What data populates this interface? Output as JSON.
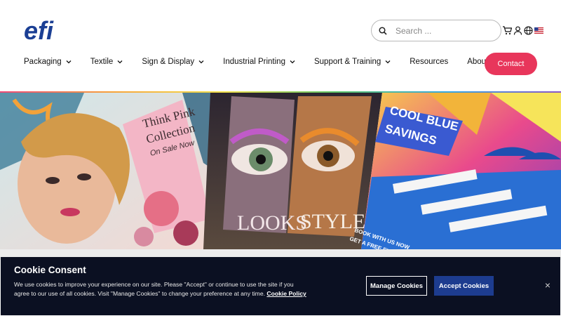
{
  "header": {
    "logo_text": "efi",
    "search": {
      "placeholder": "Search ..."
    },
    "icons": [
      "cart-icon",
      "user-icon",
      "globe-icon",
      "us-flag-icon"
    ]
  },
  "nav": {
    "items": [
      {
        "label": "Packaging",
        "dropdown": true
      },
      {
        "label": "Textile",
        "dropdown": true
      },
      {
        "label": "Sign & Display",
        "dropdown": true
      },
      {
        "label": "Industrial Printing",
        "dropdown": true
      },
      {
        "label": "Support & Training",
        "dropdown": true
      },
      {
        "label": "Resources",
        "dropdown": false
      },
      {
        "label": "About",
        "dropdown": true
      }
    ],
    "contact_label": "Contact"
  },
  "hero": {
    "panel1_line1": "Think Pink",
    "panel1_line2": "Collection",
    "panel1_line3": "On Sale Now",
    "panel2_word1": "LOOKS",
    "panel2_word2": "STYLE",
    "panel3_line1": "COOL BLUE",
    "panel3_line2": "SAVINGS",
    "panel3_footer1": "BOOK WITH US NOW",
    "panel3_footer2": "GET A FREE EXTRA"
  },
  "cookie": {
    "title": "Cookie Consent",
    "text": "We use cookies to improve your experience on our site. Please \"Accept\" or continue to use the site if you agree to our use of all cookies. Visit \"Manage Cookies\" to change your preference at any time.",
    "policy_link": "Cookie Policy",
    "manage_label": "Manage Cookies",
    "accept_label": "Accept Cookies",
    "close_label": "×"
  },
  "colors": {
    "accent": "#e8365b",
    "brand_blue": "#1d3c8f",
    "banner_bg": "#0b1022"
  }
}
